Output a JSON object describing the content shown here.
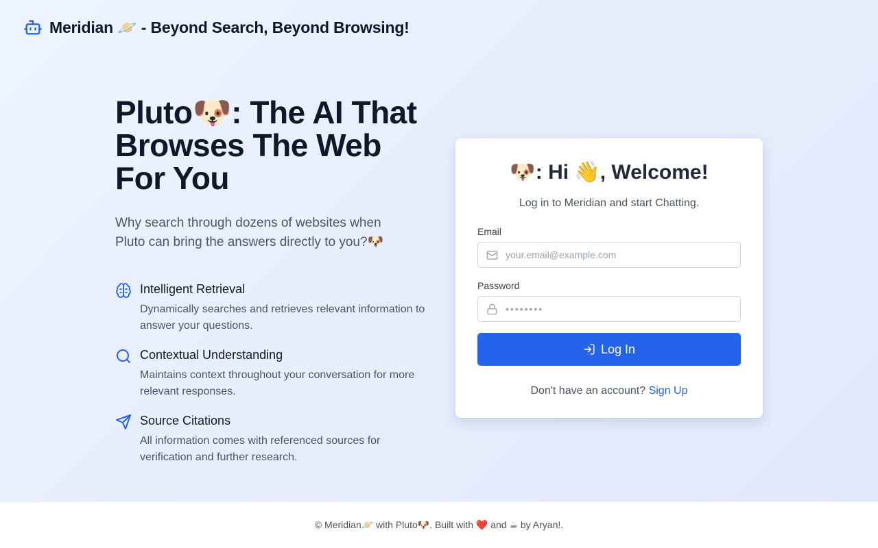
{
  "header": {
    "brand": "Meridian 🪐 - Beyond Search, Beyond Browsing!",
    "logo_icon": "robot-icon"
  },
  "hero": {
    "title": "Pluto🐶: The AI That Browses The Web For You",
    "subtitle": "Why search through dozens of websites when Pluto can bring the answers directly to you?🐶",
    "features": [
      {
        "icon": "brain-icon",
        "title": "Intelligent Retrieval",
        "description": "Dynamically searches and retrieves relevant information to answer your questions."
      },
      {
        "icon": "search-icon",
        "title": "Contextual Understanding",
        "description": "Maintains context throughout your conversation for more relevant responses."
      },
      {
        "icon": "send-icon",
        "title": "Source Citations",
        "description": "All information comes with referenced sources for verification and further research."
      }
    ]
  },
  "login": {
    "welcome": "🐶: Hi 👋, Welcome!",
    "tagline": "Log in to Meridian and start Chatting.",
    "email_label": "Email",
    "email_placeholder": "your.email@example.com",
    "password_label": "Password",
    "password_placeholder": "••••••••",
    "login_label": "Log In",
    "signup_prompt": "Don't have an account?",
    "signup_link": "Sign Up"
  },
  "footer": {
    "text": "© Meridian🪐 with Pluto🐶. Built with ❤️ and ☕ by Aryan!."
  },
  "colors": {
    "accent": "#2563eb",
    "text_dark": "#0f172a",
    "text_muted": "#4b5563"
  }
}
